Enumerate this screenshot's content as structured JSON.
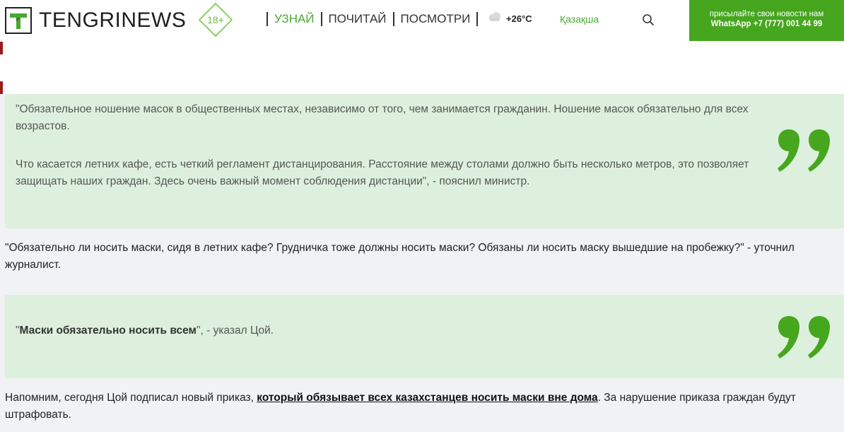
{
  "header": {
    "logo_text": "TENGRINEWS",
    "age_rating": "18+",
    "nav": [
      {
        "label": "УЗНАЙ",
        "active": true
      },
      {
        "label": "ПОЧИТАЙ",
        "active": false
      },
      {
        "label": "ПОСМОТРИ",
        "active": false
      }
    ],
    "weather": {
      "temperature": "+26°C",
      "icon": "cloud-icon"
    },
    "language_link": "Қазақша",
    "search_icon": "search-icon",
    "promo": {
      "line1": "присылайте свои новости нам",
      "line2": "WhatsApp +7 (777) 001 44 99"
    }
  },
  "colors": {
    "brand_green": "#46a61e",
    "quote_bg": "#ddf0dd",
    "page_bg": "#f1f2f4",
    "accent_red": "#9b1b1b"
  },
  "article": {
    "quote1": {
      "p1": "\"Обязательное ношение масок в общественных местах, независимо от того, чем занимается гражданин. Ношение масок обязательно для всех возрастов.",
      "p2": "Что касается летних кафе, есть четкий регламент дистанцирования. Расстояние между столами должно быть несколько метров, это позволяет защищать наших граждан. Здесь очень важный момент соблюдения дистанции\", - пояснил министр."
    },
    "paragraph1": "\"Обязательно ли носить маски, сидя в летних кафе? Грудничка тоже должны носить маски? Обязаны ли носить маску вышедшие на пробежку?\" - уточнил журналист.",
    "quote2": {
      "open_quote": "\"",
      "bold": "Маски обязательно носить всем",
      "rest": "\", - указал Цой."
    },
    "paragraph2": {
      "before": "Напомним, сегодня Цой подписал новый приказ, ",
      "link": "который обязывает всех казахстанцев носить маски вне дома",
      "after": ". За нарушение приказа граждан будут штрафовать."
    }
  }
}
